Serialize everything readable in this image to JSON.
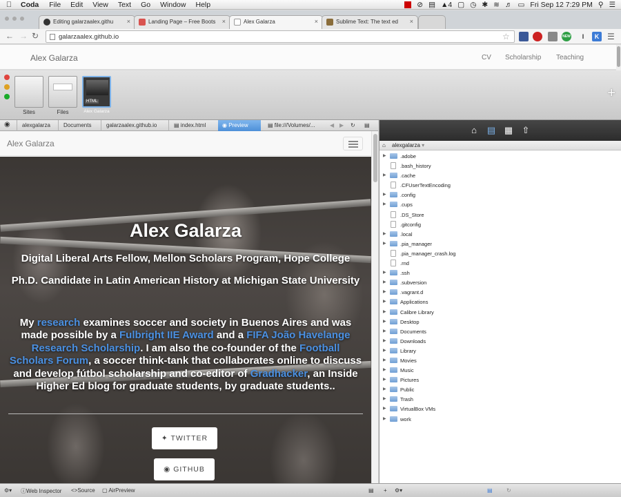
{
  "menubar": {
    "app_name": "Coda",
    "items": [
      "File",
      "Edit",
      "View",
      "Text",
      "Go",
      "Window",
      "Help"
    ],
    "battery_count": "4",
    "clock": "Fri Sep 12  7:29 PM"
  },
  "browser": {
    "tabs": [
      {
        "label": "Editing galarzaalex.githu",
        "icon": "github-icon"
      },
      {
        "label": "Landing Page – Free Boots",
        "icon": "startbootstrap-icon",
        "color": "#d9534f"
      },
      {
        "label": "Alex Galarza",
        "icon": "page-icon"
      },
      {
        "label": "Sublime Text: The text ed",
        "icon": "sublime-icon"
      }
    ],
    "url": "galarzaalex.github.io",
    "ext_labels": {
      "k": "K",
      "i": "I",
      "new": "NEW"
    }
  },
  "site_header": {
    "brand": "Alex Galarza",
    "nav": [
      "CV",
      "Scholarship",
      "Teaching"
    ]
  },
  "coda": {
    "thumbnails": [
      {
        "label": "Sites"
      },
      {
        "label": "Files"
      },
      {
        "label": "Alex Galarza",
        "badge": "HTML"
      }
    ],
    "path": [
      "alexgalarza",
      "Documents",
      "galarzaalex.github.io",
      "index.html"
    ],
    "preview_label": "Preview",
    "preview_url": "file:///Volumes/...",
    "bottom": {
      "web_inspector": "Web Inspector",
      "source": "Source",
      "airpreview": "AirPreview"
    }
  },
  "preview": {
    "brand": "Alex Galarza",
    "name": "Alex Galarza",
    "subtitle1": "Digital Liberal Arts Fellow, Mellon Scholars Program, Hope College",
    "subtitle2": "Ph.D. Candidate in Latin American History at Michigan State University",
    "bio": {
      "t1": "My ",
      "l1": "research",
      "t2": " examines soccer and society in Buenos Aires and was made possible by a ",
      "l2": "Fulbright IIE Award",
      "t3": " and a ",
      "l3": "FIFA João Havelange Research Scholarship",
      "t4": ". I am also the co-founder of the ",
      "l4": "Football Scholars Forum",
      "t5": ", a soccer think-tank that collaborates online to discuss and develop fútbol scholarship and co-editor of ",
      "l5": "Gradhacker",
      "t6": ", an Inside Higher Ed blog for graduate students, by graduate students.."
    },
    "twitter_label": "TWITTER",
    "github_label": "GITHUB"
  },
  "files_panel": {
    "root": "alexgalarza",
    "entries": [
      {
        "name": ".adobe",
        "type": "folder"
      },
      {
        "name": ".bash_history",
        "type": "file"
      },
      {
        "name": ".cache",
        "type": "folder"
      },
      {
        "name": ".CFUserTextEncoding",
        "type": "file"
      },
      {
        "name": ".config",
        "type": "folder"
      },
      {
        "name": ".cups",
        "type": "folder"
      },
      {
        "name": ".DS_Store",
        "type": "file"
      },
      {
        "name": ".gitconfig",
        "type": "file"
      },
      {
        "name": ".local",
        "type": "folder"
      },
      {
        "name": ".pia_manager",
        "type": "folder"
      },
      {
        "name": ".pia_manager_crash.log",
        "type": "file"
      },
      {
        "name": ".rnd",
        "type": "file"
      },
      {
        "name": ".ssh",
        "type": "folder"
      },
      {
        "name": ".subversion",
        "type": "folder"
      },
      {
        "name": ".vagrant.d",
        "type": "folder"
      },
      {
        "name": "Applications",
        "type": "folder"
      },
      {
        "name": "Calibre Library",
        "type": "folder"
      },
      {
        "name": "Desktop",
        "type": "folder"
      },
      {
        "name": "Documents",
        "type": "folder"
      },
      {
        "name": "Downloads",
        "type": "folder"
      },
      {
        "name": "Library",
        "type": "folder"
      },
      {
        "name": "Movies",
        "type": "folder"
      },
      {
        "name": "Music",
        "type": "folder"
      },
      {
        "name": "Pictures",
        "type": "folder"
      },
      {
        "name": "Public",
        "type": "folder"
      },
      {
        "name": "Trash",
        "type": "folder"
      },
      {
        "name": "VirtualBox VMs",
        "type": "folder"
      },
      {
        "name": "work",
        "type": "folder"
      }
    ]
  },
  "colors": {
    "link": "#4a90e2",
    "preview_active": "#4d8fd8",
    "files_toolbar": "#2c2c2c"
  }
}
